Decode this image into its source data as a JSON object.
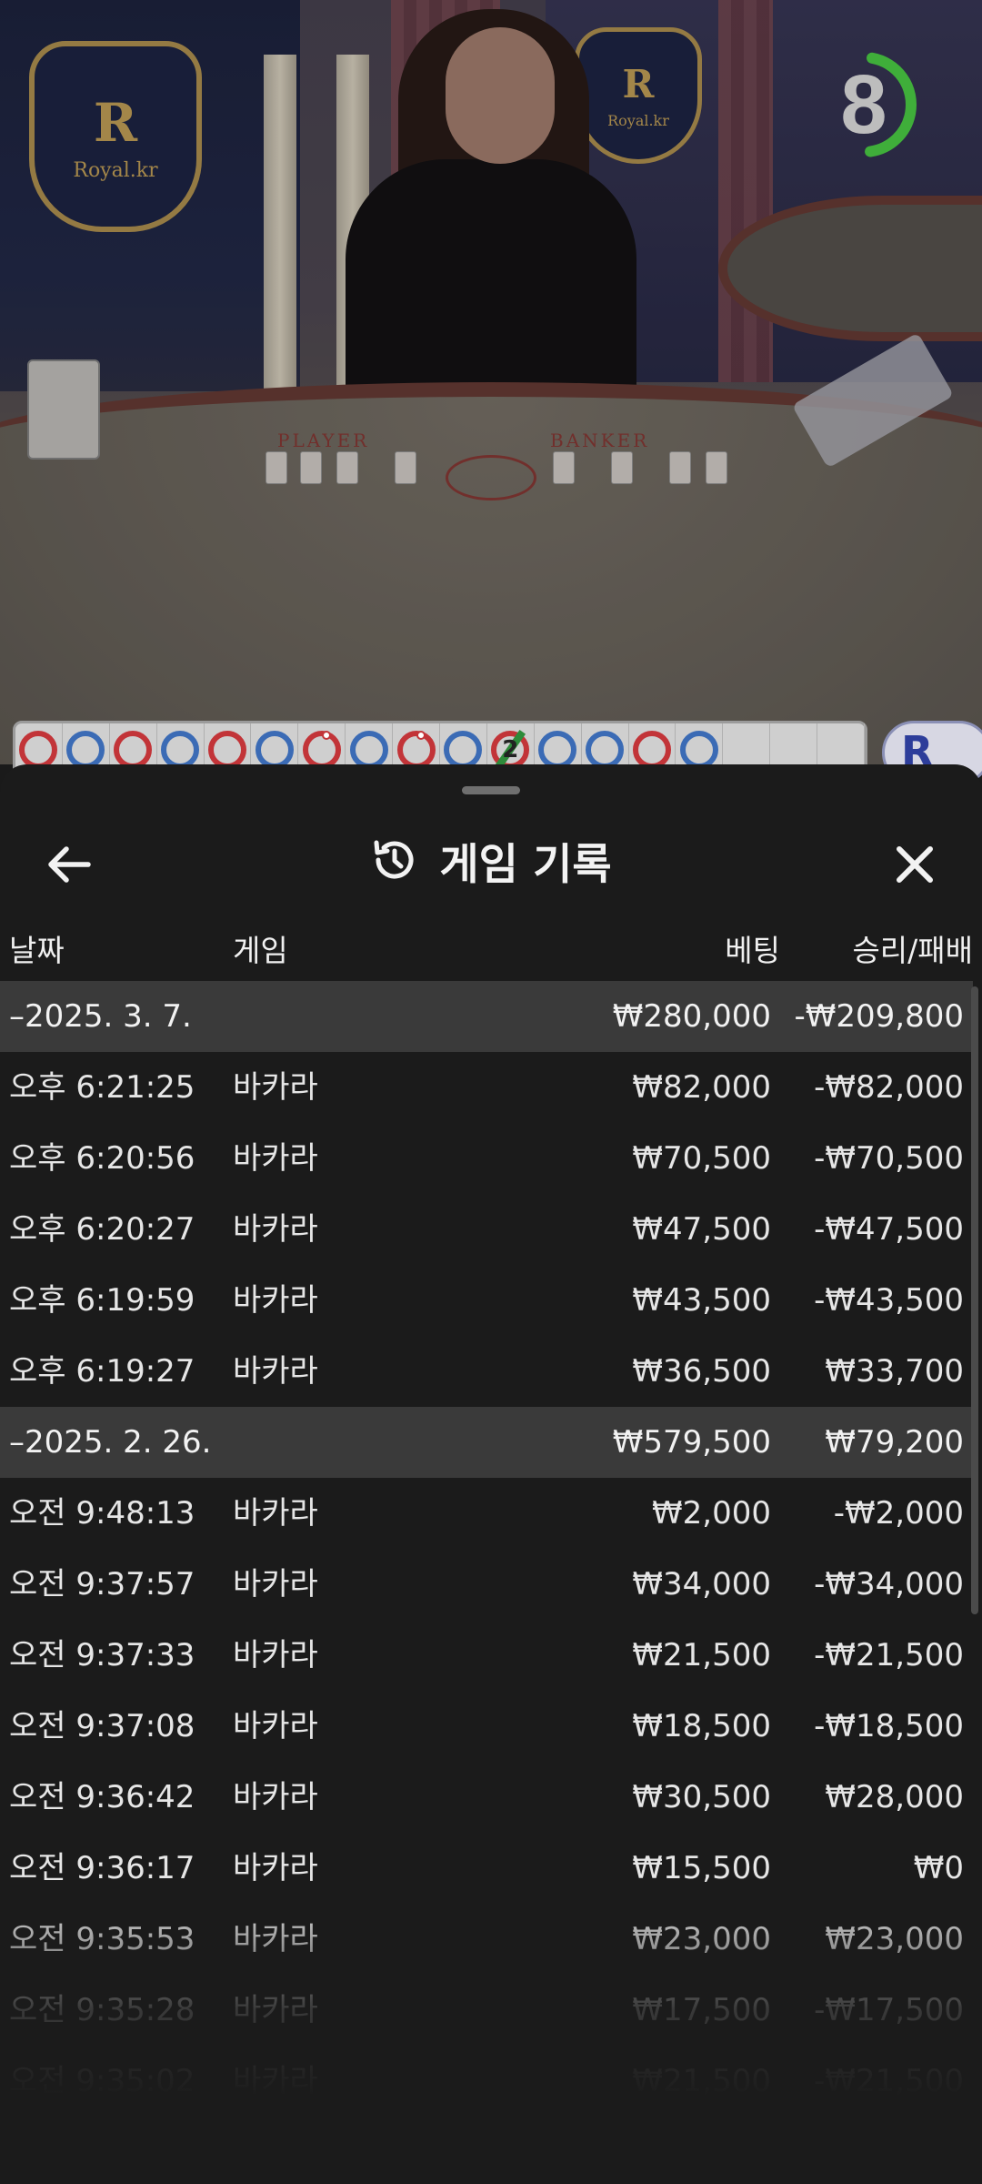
{
  "video": {
    "brand_left": "Royal.kr",
    "brand_right": "Royal.kr",
    "crest_letter": "R",
    "table_label_player": "PLAYER",
    "table_label_banker": "BANKER",
    "timer_value": "8",
    "timer_progress": 0.45
  },
  "road": {
    "results": [
      "B",
      "P",
      "B",
      "P",
      "B",
      "P",
      "B",
      "P",
      "B",
      "P",
      "B",
      "P",
      "P",
      "B",
      "P"
    ],
    "tie_count": "2"
  },
  "badge": {
    "label": "R"
  },
  "sheet": {
    "title": "게임 기록",
    "back_icon": "arrow-left-icon",
    "close_icon": "close-icon",
    "history_icon": "history-icon"
  },
  "columns": {
    "date": "날짜",
    "game": "게임",
    "bet": "베팅",
    "win_loss": "승리/패배"
  },
  "groups": [
    {
      "date": "–2025. 3. 7.",
      "bet": "₩280,000",
      "win_loss": "-₩209,800",
      "rows": [
        {
          "time": "오후 6:21:25",
          "game": "바카라",
          "bet": "₩82,000",
          "win_loss": "-₩82,000"
        },
        {
          "time": "오후 6:20:56",
          "game": "바카라",
          "bet": "₩70,500",
          "win_loss": "-₩70,500"
        },
        {
          "time": "오후 6:20:27",
          "game": "바카라",
          "bet": "₩47,500",
          "win_loss": "-₩47,500"
        },
        {
          "time": "오후 6:19:59",
          "game": "바카라",
          "bet": "₩43,500",
          "win_loss": "-₩43,500"
        },
        {
          "time": "오후 6:19:27",
          "game": "바카라",
          "bet": "₩36,500",
          "win_loss": "₩33,700"
        }
      ]
    },
    {
      "date": "–2025. 2. 26.",
      "bet": "₩579,500",
      "win_loss": "₩79,200",
      "rows": [
        {
          "time": "오전 9:48:13",
          "game": "바카라",
          "bet": "₩2,000",
          "win_loss": "-₩2,000"
        },
        {
          "time": "오전 9:37:57",
          "game": "바카라",
          "bet": "₩34,000",
          "win_loss": "-₩34,000"
        },
        {
          "time": "오전 9:37:33",
          "game": "바카라",
          "bet": "₩21,500",
          "win_loss": "-₩21,500"
        },
        {
          "time": "오전 9:37:08",
          "game": "바카라",
          "bet": "₩18,500",
          "win_loss": "-₩18,500"
        },
        {
          "time": "오전 9:36:42",
          "game": "바카라",
          "bet": "₩30,500",
          "win_loss": "₩28,000"
        },
        {
          "time": "오전 9:36:17",
          "game": "바카라",
          "bet": "₩15,500",
          "win_loss": "₩0"
        },
        {
          "time": "오전 9:35:53",
          "game": "바카라",
          "bet": "₩23,000",
          "win_loss": "₩23,000"
        },
        {
          "time": "오전 9:35:28",
          "game": "바카라",
          "bet": "₩17,500",
          "win_loss": "-₩17,500"
        },
        {
          "time": "오전 9:35:02",
          "game": "바카라",
          "bet": "₩21,500",
          "win_loss": "-₩21,500"
        }
      ]
    }
  ],
  "colors": {
    "banker": "#c23438",
    "player": "#3b6bb5",
    "tie": "#2e8b3a",
    "timer": "#3fae3a",
    "sheet_bg": "#1b1b1b",
    "group_bg": "#3a3a3a"
  }
}
